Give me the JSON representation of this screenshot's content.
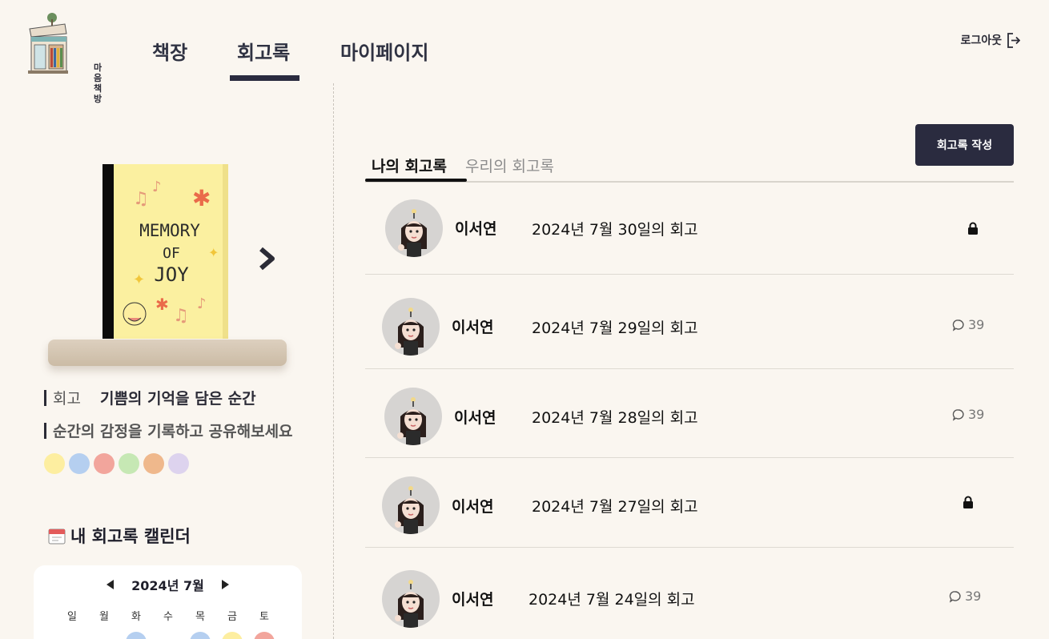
{
  "brand": {
    "logo_text_line1": "마음",
    "logo_text_line2": "책방"
  },
  "nav": {
    "items": [
      {
        "label": "책장"
      },
      {
        "label": "회고록"
      },
      {
        "label": "마이페이지"
      }
    ]
  },
  "header": {
    "logout_label": "로그아웃"
  },
  "left": {
    "book_cover_line1": "MEMORY",
    "book_cover_line2": "OF",
    "book_cover_line3": "JOY",
    "category_label": "회고",
    "book_title": "기쁨의 기억을 담은 순간",
    "description": "순간의 감정을 기록하고 공유해보세요",
    "swatch_colors": [
      "#fdeea0",
      "#b5cff0",
      "#f2a59c",
      "#c6e8b4",
      "#efb88c",
      "#ddd3ee"
    ],
    "calendar_title": "내 회고록 캘린더",
    "calendar": {
      "month_label": "2024년 7월",
      "weekdays": [
        "일",
        "월",
        "화",
        "수",
        "목",
        "금",
        "토"
      ],
      "dot_colors": [
        "",
        "",
        "#b5cff0",
        "",
        "#b5cff0",
        "#fdeea0",
        "#f2a59c"
      ]
    }
  },
  "main": {
    "write_button_label": "회고록 작성",
    "tabs": [
      {
        "label": "나의 회고록"
      },
      {
        "label": "우리의 회고록"
      }
    ],
    "rows": [
      {
        "author": "이서연",
        "title": "2024년 7월 30일의 회고",
        "locked": true
      },
      {
        "author": "이서연",
        "title": "2024년 7월 29일의 회고",
        "comments": "39"
      },
      {
        "author": "이서연",
        "title": "2024년 7월 28일의 회고",
        "comments": "39"
      },
      {
        "author": "이서연",
        "title": "2024년 7월 27일의 회고",
        "locked": true
      },
      {
        "author": "이서연",
        "title": "2024년 7월 24일의 회고",
        "comments": "39"
      }
    ]
  }
}
